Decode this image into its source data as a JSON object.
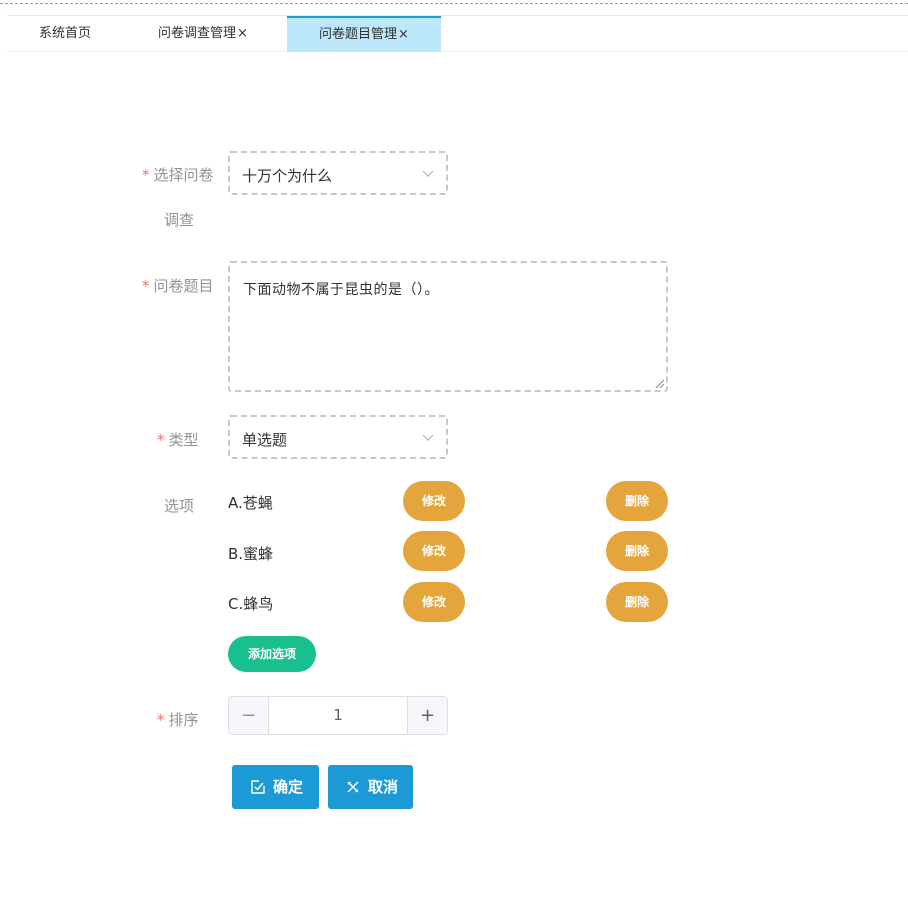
{
  "tabs": [
    {
      "label": "系统首页",
      "closable": false
    },
    {
      "label": "问卷调查管理",
      "closable": true
    },
    {
      "label": "问卷题目管理",
      "closable": true,
      "active": true
    }
  ],
  "tab_close_glyph": "×",
  "form": {
    "required_mark": "*",
    "survey": {
      "label_line1": "选择问卷",
      "label_line2": "调查",
      "value": "十万个为什么"
    },
    "question": {
      "label": "问卷题目",
      "value": "下面动物不属于昆虫的是（）。"
    },
    "type": {
      "label": "类型",
      "value": "单选题"
    },
    "options": {
      "label": "选项",
      "items": [
        {
          "text": "A.苍蝇",
          "edit_label": "修改",
          "delete_label": "删除"
        },
        {
          "text": "B.蜜蜂",
          "edit_label": "修改",
          "delete_label": "删除"
        },
        {
          "text": "C.蜂鸟",
          "edit_label": "修改",
          "delete_label": "删除"
        }
      ],
      "add_label": "添加选项"
    },
    "sort": {
      "label": "排序",
      "value": "1",
      "minus": "−",
      "plus": "+"
    },
    "confirm_label": "确定",
    "cancel_label": "取消"
  },
  "colors": {
    "tab_active_bg": "#bde7fb",
    "tab_active_border": "#1f9ad6",
    "required": "#f56c6c",
    "option_button": "#e4a63c",
    "add_button": "#18c08f",
    "action_button": "#1b9ad6"
  },
  "icons": {
    "select_arrow": "chevron-down-icon",
    "confirm": "edit-check-icon",
    "cancel": "close-icon"
  }
}
